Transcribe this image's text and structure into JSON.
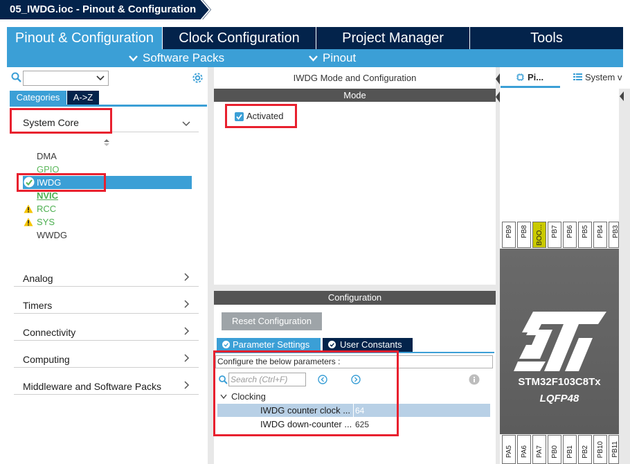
{
  "window": {
    "title": "05_IWDG.ioc - Pinout & Configuration"
  },
  "tabs": [
    {
      "label": "Pinout & Configuration",
      "active": true
    },
    {
      "label": "Clock Configuration",
      "active": false
    },
    {
      "label": "Project Manager",
      "active": false
    },
    {
      "label": "Tools",
      "active": false
    }
  ],
  "subbar": {
    "software_packs": "Software Packs",
    "pinout": "Pinout"
  },
  "left": {
    "search": {
      "value": ""
    },
    "tab_categories": "Categories",
    "tab_az": "A->Z",
    "system_core": "System Core",
    "system_core_items": [
      {
        "label": "DMA",
        "color": "#3a3a3a",
        "status": "none"
      },
      {
        "label": "GPIO",
        "color": "#5cb85c",
        "status": "none"
      },
      {
        "label": "IWDG",
        "color": "#ffffff",
        "status": "ok"
      },
      {
        "label": "NVIC",
        "color": "#4caf50",
        "status": "none"
      },
      {
        "label": "RCC",
        "color": "#4caf50",
        "status": "warning"
      },
      {
        "label": "SYS",
        "color": "#4caf50",
        "status": "warning"
      },
      {
        "label": "WWDG",
        "color": "#3a3a3a",
        "status": "none"
      }
    ],
    "categories": [
      "Analog",
      "Timers",
      "Connectivity",
      "Computing",
      "Middleware and Software Packs"
    ]
  },
  "mode": {
    "title": "IWDG Mode and Configuration",
    "section": "Mode",
    "activated_label": "Activated",
    "activated": true
  },
  "config": {
    "section": "Configuration",
    "reset_button": "Reset Configuration",
    "tab_parameters": "Parameter Settings",
    "tab_user_constants": "User Constants",
    "intro": "Configure the below parameters :",
    "search_placeholder": "Search (Ctrl+F)",
    "group": "Clocking",
    "params": [
      {
        "name": "IWDG counter clock ...",
        "value": "64"
      },
      {
        "name": "IWDG down-counter ...",
        "value": "625"
      }
    ]
  },
  "pinout": {
    "tab_pinout": "Pi...",
    "tab_system": "System v",
    "top_pins": [
      "PB9",
      "PB8",
      "BOO...",
      "PB7",
      "PB6",
      "PB5",
      "PB4",
      "PB3"
    ],
    "bottom_pins": [
      "PA5",
      "PA6",
      "PA7",
      "PB0",
      "PB1",
      "PB2",
      "PB10",
      "PB11"
    ],
    "chip_name": "STM32F103C8Tx",
    "chip_package": "LQFP48",
    "boot_pin_color": "#c9c900"
  }
}
